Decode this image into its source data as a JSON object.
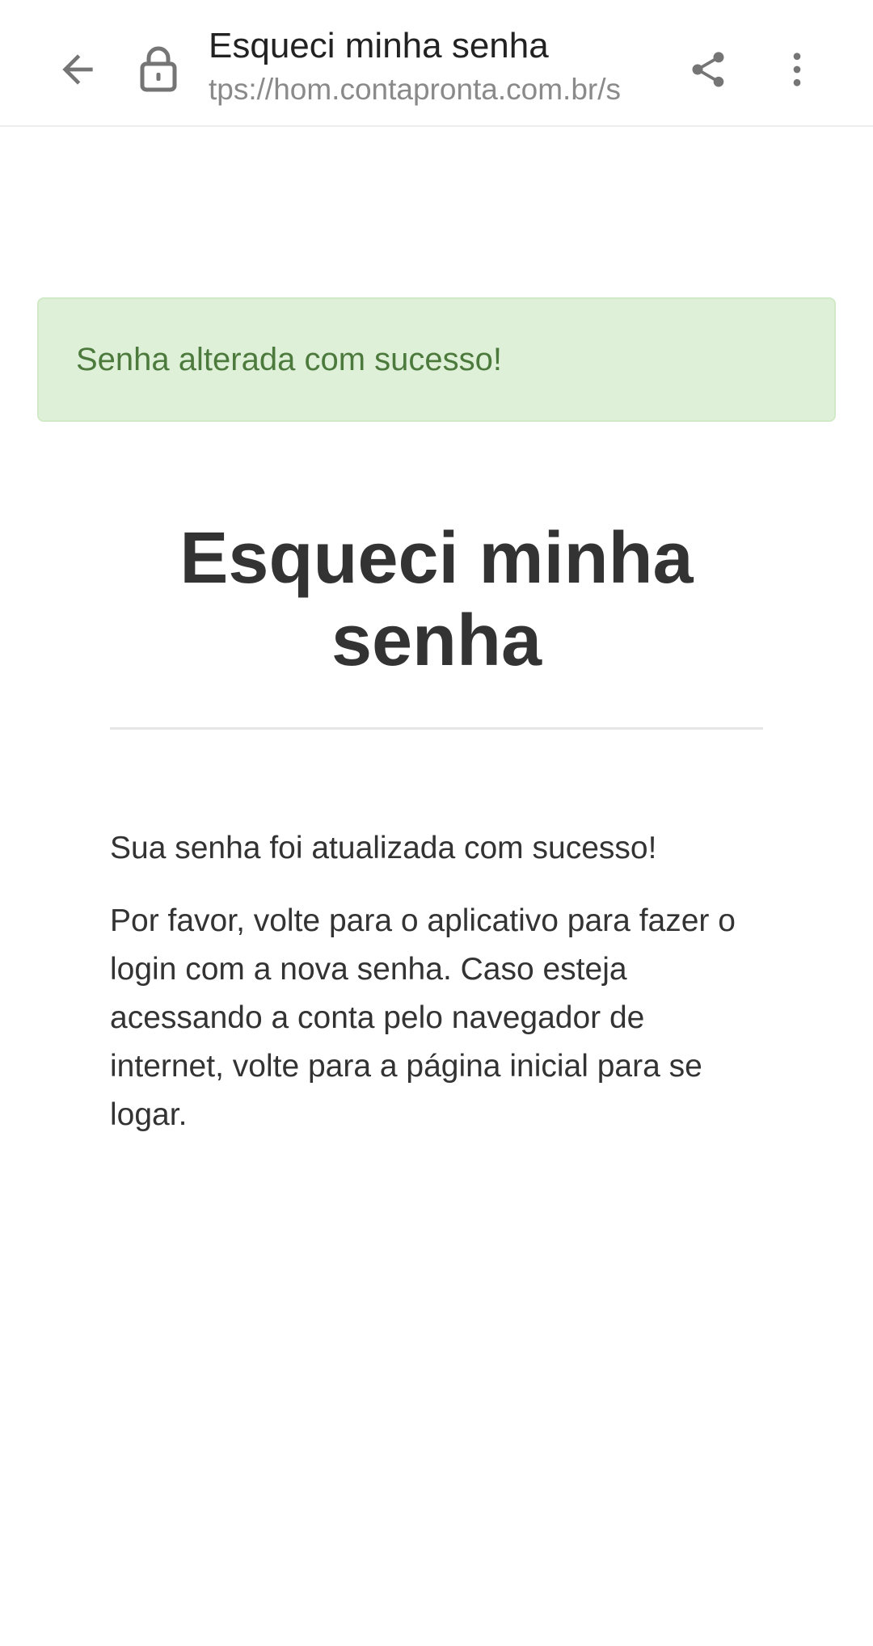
{
  "browser": {
    "tab_title": "Esqueci minha senha",
    "url": "tps://hom.contapronta.com.br/s",
    "icons": {
      "back": "arrow-left-icon",
      "lock": "lock-icon",
      "share": "share-icon",
      "more": "more-vert-icon"
    }
  },
  "alert": {
    "message": "Senha alterada com sucesso!",
    "background": "#dff0d8",
    "text_color": "#4c7a3d"
  },
  "page": {
    "title": "Esqueci minha senha",
    "paragraph_1": "Sua senha foi atualizada com sucesso!",
    "paragraph_2": "Por favor, volte para o aplicativo para fazer o login com a nova senha. Caso esteja acessando a conta pelo navegador de internet, volte para a página inicial para se logar."
  }
}
